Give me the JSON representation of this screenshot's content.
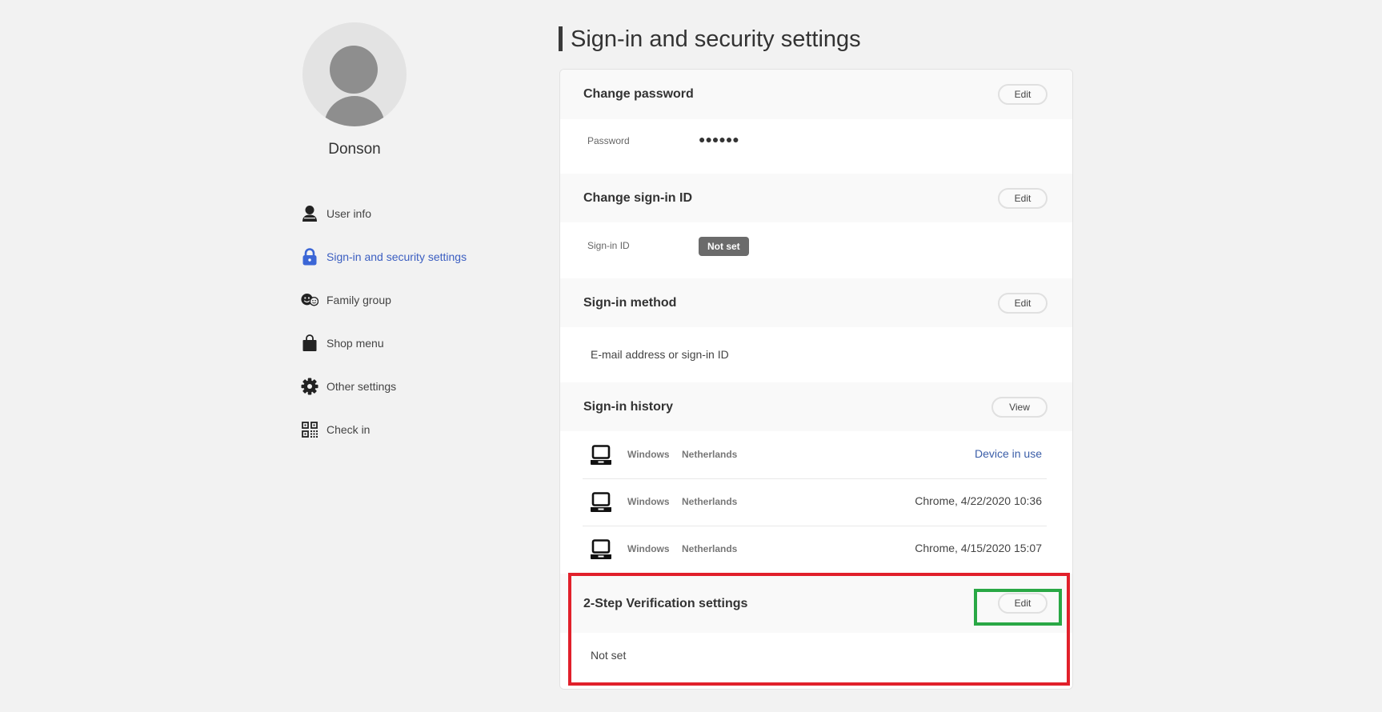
{
  "user": {
    "name": "Donson",
    "avatar_icon": "default-user-avatar"
  },
  "sidebar": {
    "items": [
      {
        "label": "User info",
        "icon": "person-icon",
        "active": false
      },
      {
        "label": "Sign-in and security settings",
        "icon": "lock-icon",
        "active": true
      },
      {
        "label": "Family group",
        "icon": "family-icon",
        "active": false
      },
      {
        "label": "Shop menu",
        "icon": "shopping-bag-icon",
        "active": false
      },
      {
        "label": "Other settings",
        "icon": "gear-icon",
        "active": false
      },
      {
        "label": "Check in",
        "icon": "qr-code-icon",
        "active": false
      }
    ]
  },
  "colors": {
    "accent": "#3b5ec1",
    "link": "#3b5ea8",
    "badge_bg": "#6b6b6b",
    "annotation_red": "#e1202b",
    "annotation_green": "#29a845"
  },
  "page": {
    "title": "Sign-in and security settings"
  },
  "sections": {
    "password": {
      "heading": "Change password",
      "button": "Edit",
      "label": "Password",
      "value": "●●●●●●"
    },
    "signin_id": {
      "heading": "Change sign-in ID",
      "button": "Edit",
      "label": "Sign-in ID",
      "value": "Not set"
    },
    "signin_method": {
      "heading": "Sign-in method",
      "button": "Edit",
      "value": "E-mail address or sign-in ID"
    },
    "history": {
      "heading": "Sign-in history",
      "button": "View",
      "rows": [
        {
          "os": "Windows",
          "location": "Netherlands",
          "detail": "Device in use",
          "is_link": true
        },
        {
          "os": "Windows",
          "location": "Netherlands",
          "detail": "Chrome, 4/22/2020 10:36",
          "is_link": false
        },
        {
          "os": "Windows",
          "location": "Netherlands",
          "detail": "Chrome, 4/15/2020 15:07",
          "is_link": false
        }
      ]
    },
    "two_step": {
      "heading": "2-Step Verification settings",
      "button": "Edit",
      "value": "Not set"
    }
  }
}
